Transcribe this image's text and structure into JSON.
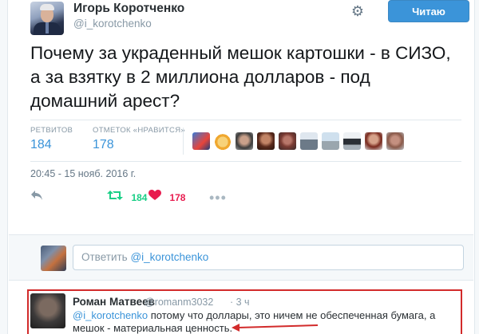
{
  "author": {
    "name": "Игорь Коротченко",
    "handle": "@i_korotchenko"
  },
  "header": {
    "settings_icon": "gear-icon",
    "follow_label": "Читаю"
  },
  "tweet": {
    "text": "Почему за украденный мешок картошки - в СИЗО, а за взятку в 2 миллиона долларов - под домашний арест?",
    "timestamp": "20:45 - 15 нояб. 2016 г."
  },
  "stats": {
    "retweets_label": "РЕТВИТОВ",
    "retweets_value": "184",
    "likes_label": "ОТМЕТОК «НРАВИТСЯ»",
    "likes_value": "178",
    "liker_avatar_count": 10
  },
  "actions": {
    "reply_icon": "reply-icon",
    "retweet_icon": "retweet-icon",
    "retweet_count": "184",
    "like_icon": "heart-icon",
    "like_count": "178",
    "more_icon": "more-icon"
  },
  "reply_box": {
    "placeholder_prefix": "Ответить ",
    "placeholder_mention": "@i_korotchenko"
  },
  "reply": {
    "name": "Роман Матвеев",
    "handle": "@romanm3032",
    "time": "· 3 ч",
    "mention": "@i_korotchenko",
    "text": " потому что доллары, это ничем не обеспеченная бумага, а мешок -  материальная ценность.",
    "highlight_color": "#d22b2b"
  },
  "colors": {
    "accent": "#3b94d9",
    "retweet": "#19cf86",
    "like": "#e81c4f",
    "muted": "#8899a6"
  }
}
